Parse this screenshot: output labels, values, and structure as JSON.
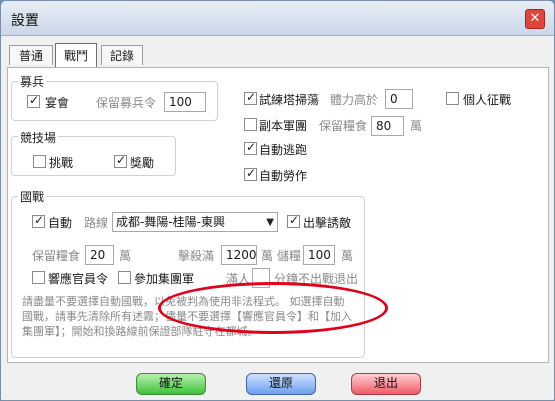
{
  "window": {
    "title": "設置"
  },
  "tabs": [
    {
      "label": "普通"
    },
    {
      "label": "戰鬥"
    },
    {
      "label": "記錄"
    }
  ],
  "recruit": {
    "group_title": "募兵",
    "banquet_label": "宴會",
    "banquet_checked": true,
    "reserve_label": "保留募兵令",
    "reserve_value": "100"
  },
  "arena": {
    "group_title": "競技場",
    "challenge_label": "挑戰",
    "challenge_checked": false,
    "reward_label": "獎勵",
    "reward_checked": true
  },
  "right_options": {
    "trial_tower_label": "試練塔掃蕩",
    "trial_tower_checked": true,
    "hp_above_label": "體力高於",
    "hp_above_value": "0",
    "personal_expedition_label": "個人征戰",
    "personal_expedition_checked": false,
    "dungeon_army_label": "副本軍團",
    "dungeon_army_checked": false,
    "keep_grain_label": "保留糧食",
    "keep_grain_value": "80",
    "keep_grain_unit": "萬",
    "auto_escape_label": "自動逃跑",
    "auto_escape_checked": true,
    "auto_labor_label": "自動勞作",
    "auto_labor_checked": true
  },
  "national_war": {
    "group_title": "國戰",
    "auto_label": "自動",
    "auto_checked": true,
    "route_label": "路線",
    "route_value": "成都-舞陽-桂陽-東興",
    "attack_enemy_label": "出擊誘敵",
    "attack_enemy_checked": true,
    "keep_grain_label": "保留糧食",
    "keep_grain_value": "20",
    "keep_grain_unit": "萬",
    "kill_full_label": "擊殺滿",
    "kill_full_value": "1200",
    "kill_full_unit": "萬",
    "storage_label": "儲糧",
    "storage_value": "100",
    "storage_unit": "萬",
    "response_order_label": "響應官員令",
    "response_order_checked": false,
    "join_army_label": "參加集團軍",
    "join_army_checked": false,
    "full_label": "滿人",
    "exit_label": "分鐘不出戰退出",
    "note": "請盡量不要選擇自動國戰，以免被判為使用非法程式。 如選擇自動國戰，請事先清除所有述霧；儘量不要選擇【響應官員令】和【加入集團軍】；開始和換路線前保證部隊駐守在都城。"
  },
  "buttons": {
    "ok": "確定",
    "restore": "還原",
    "exit": "退出"
  },
  "colors": {
    "titlebar": "#d7e2ef",
    "highlight_ellipse": "#e3001b",
    "ok_button": "#3ec23a",
    "restore_button": "#6d9ef0",
    "exit_button": "#f05a68"
  }
}
